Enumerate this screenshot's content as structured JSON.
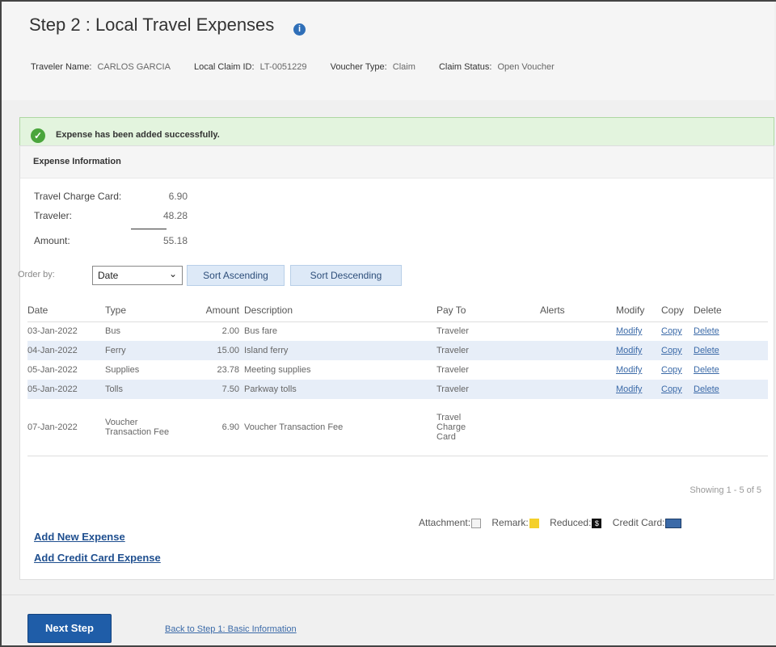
{
  "header": {
    "title": "Step 2 : Local Travel Expenses",
    "help_icon": "info-icon",
    "traveler_name_label": "Traveler Name:",
    "traveler_name": "CARLOS GARCIA",
    "claim_id_label": "Local Claim ID:",
    "claim_id": "LT-0051229",
    "voucher_type_label": "Voucher Type:",
    "voucher_type": "Claim",
    "claim_status_label": "Claim Status:",
    "claim_status": "Open Voucher"
  },
  "alert": {
    "icon": "check-circle-icon",
    "message": "Expense has been added successfully.",
    "color": "#4aa53c"
  },
  "panel": {
    "title": "Expense Information",
    "summary": {
      "travel_charge_card_label": "Travel Charge Card:",
      "travel_charge_card_value": "6.90",
      "traveler_label": "Traveler:",
      "traveler_value": "48.28",
      "amount_label": "Amount:",
      "amount_value": "55.18"
    },
    "order_by_label": "Order by:",
    "order_by_selected": "Date",
    "sort_ascending": "Sort Ascending",
    "sort_descending": "Sort Descending",
    "columns": [
      "Date",
      "Type",
      "Amount",
      "Description",
      "Pay To",
      "Alerts",
      "Modify",
      "Copy",
      "Delete"
    ],
    "rows": [
      {
        "date": "03-Jan-2022",
        "type": "Bus",
        "amount": "2.00",
        "description": "Bus fare",
        "pay_to": "Traveler",
        "modify": "Modify",
        "copy": "Copy",
        "delete": "Delete"
      },
      {
        "date": "04-Jan-2022",
        "type": "Ferry",
        "amount": "15.00",
        "description": "Island ferry",
        "pay_to": "Traveler",
        "modify": "Modify",
        "copy": "Copy",
        "delete": "Delete"
      },
      {
        "date": "05-Jan-2022",
        "type": "Supplies",
        "amount": "23.78",
        "description": "Meeting supplies",
        "pay_to": "Traveler",
        "modify": "Modify",
        "copy": "Copy",
        "delete": "Delete"
      },
      {
        "date": "05-Jan-2022",
        "type": "Tolls",
        "amount": "7.50",
        "description": "Parkway tolls",
        "pay_to": "Traveler",
        "modify": "Modify",
        "copy": "Copy",
        "delete": "Delete"
      },
      {
        "date": "07-Jan-2022",
        "type_line1": "Voucher",
        "type_line2": "Transaction Fee",
        "amount": "6.90",
        "description": "Voucher Transaction Fee",
        "pay_to_line1": "Travel",
        "pay_to_line2": "Charge",
        "pay_to_line3": "Card"
      }
    ],
    "showing": "Showing 1 - 5 of 5",
    "legend": {
      "attachment": "Attachment:",
      "remark": "Remark:",
      "reduced": "Reduced:",
      "credit_card": "Credit Card:"
    },
    "add_new_expense": "Add New Expense",
    "add_credit_card_expense": "Add Credit Card Expense"
  },
  "footer": {
    "next_step": "Next Step",
    "back_link": "Back to Step 1: Basic Information"
  }
}
